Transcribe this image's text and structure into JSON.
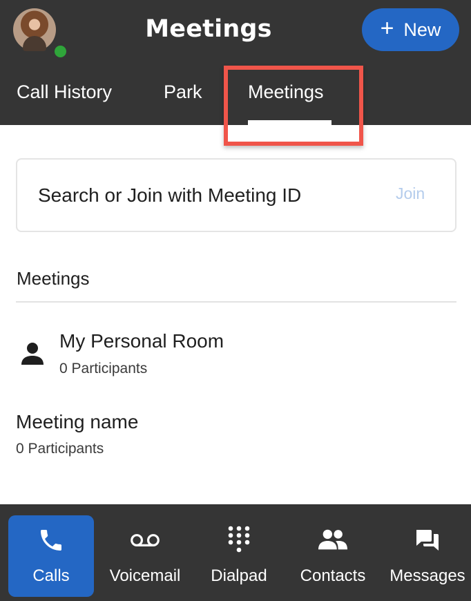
{
  "header": {
    "title": "Meetings",
    "new_button_icon": "plus-icon",
    "new_button_label": "New",
    "presence_status_color": "#2fa53a"
  },
  "tabs": [
    {
      "label": "Call History"
    },
    {
      "label": "Park"
    },
    {
      "label": "Meetings",
      "selected": true
    }
  ],
  "search": {
    "placeholder": "Search or Join with Meeting ID",
    "value": "",
    "join_label": "Join"
  },
  "meetings_section": {
    "title": "Meetings",
    "items": [
      {
        "icon": "person-icon",
        "name": "My Personal Room",
        "participants": "0 Participants"
      },
      {
        "name": "Meeting name",
        "participants": "0 Participants"
      }
    ]
  },
  "bottom_nav": [
    {
      "icon": "phone-icon",
      "label": "Calls",
      "active": true
    },
    {
      "icon": "voicemail-icon",
      "label": "Voicemail"
    },
    {
      "icon": "dialpad-icon",
      "label": "Dialpad"
    },
    {
      "icon": "contacts-icon",
      "label": "Contacts"
    },
    {
      "icon": "messages-icon",
      "label": "Messages"
    }
  ],
  "colors": {
    "header_bg": "#353535",
    "accent": "#2467c4",
    "highlight": "#f0554a",
    "join_disabled": "#b4ccec"
  }
}
